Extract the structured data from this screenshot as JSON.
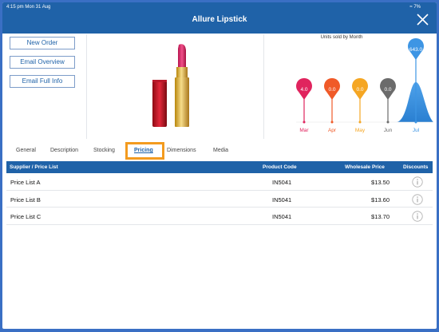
{
  "status_bar": {
    "time_date": "4:15 pm  Mon 31 Aug",
    "battery": "7%"
  },
  "header": {
    "title": "Allure Lipstick"
  },
  "actions": [
    {
      "label": "New Order"
    },
    {
      "label": "Email Overview"
    },
    {
      "label": "Email Full Info"
    }
  ],
  "chart_data": {
    "type": "area",
    "title": "Units sold by Month",
    "categories": [
      "Mar",
      "Apr",
      "May",
      "Jun",
      "Jul"
    ],
    "values": [
      4.0,
      0.0,
      0.0,
      0.0,
      643.0
    ],
    "labels": [
      "4.0",
      "0.0",
      "0.0",
      "0.0",
      "643.0"
    ],
    "colors": [
      "#e0245e",
      "#f05a28",
      "#f5a623",
      "#6b6b6b",
      "#3d95e4"
    ]
  },
  "tabs": [
    {
      "label": "General"
    },
    {
      "label": "Description"
    },
    {
      "label": "Stocking"
    },
    {
      "label": "Pricing"
    },
    {
      "label": "Dimensions"
    },
    {
      "label": "Media"
    }
  ],
  "active_tab": "Pricing",
  "table": {
    "headers": [
      "Supplier / Price List",
      "Product Code",
      "Wholesale Price",
      "Discounts"
    ],
    "rows": [
      {
        "supplier": "Price List A",
        "code": "IN5041",
        "price": "$13.50"
      },
      {
        "supplier": "Price List B",
        "code": "IN5041",
        "price": "$13.60"
      },
      {
        "supplier": "Price List C",
        "code": "IN5041",
        "price": "$13.70"
      }
    ]
  }
}
